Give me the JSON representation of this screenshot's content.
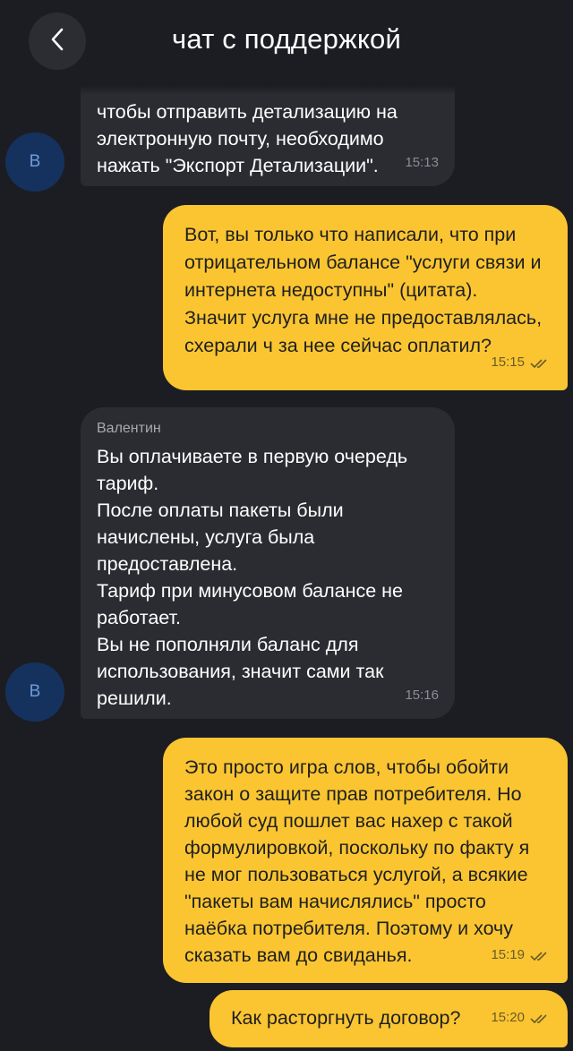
{
  "header": {
    "title": "чат с поддержкой"
  },
  "messages": [
    {
      "direction": "in",
      "text": "чтобы отправить детализацию на\nэлектронную почту, необходимо\nнажать \"Экспорт Детализации\".",
      "time": "15:13",
      "avatar": "В"
    },
    {
      "direction": "out",
      "text": "Вот, вы только что написали, что при\nотрицательном балансе \"услуги связи и\nинтернета недоступны\" (цитата).\nЗначит услуга мне не предоставлялась,\nсхерали ч за нее сейчас оплатил?",
      "time": "15:15"
    },
    {
      "direction": "in",
      "sender": "Валентин",
      "text": "Вы оплачиваете в первую очередь\nтариф.\nПосле оплаты пакеты были\nначислены, услуга была\nпредоставлена.\nТариф при минусовом балансе не\nработает.\nВы не пополняли баланс для\nиспользования, значит сами так\nрешили.",
      "time": "15:16",
      "avatar": "В"
    },
    {
      "direction": "out",
      "text": "Это просто игра слов, чтобы обойти\nзакон о защите прав потребителя. Но\nлюбой суд пошлет вас нахер с такой\nформулировкой, поскольку по факту я\nне мог пользоваться услугой, а всякие\n\"пакеты вам начислялись\" просто\nнаёбка потребителя. Поэтому и хочу\nсказать вам до свиданья.",
      "time": "15:19"
    },
    {
      "direction": "out",
      "text": "Как расторгнуть договор?",
      "time": "15:20"
    }
  ],
  "icons": {
    "back": "chevron-left-icon",
    "read": "double-check-icon"
  },
  "colors": {
    "background": "#1c1d22",
    "incoming_bubble": "#2b2c32",
    "outgoing_bubble": "#fac531",
    "avatar_bg": "#15325e"
  }
}
